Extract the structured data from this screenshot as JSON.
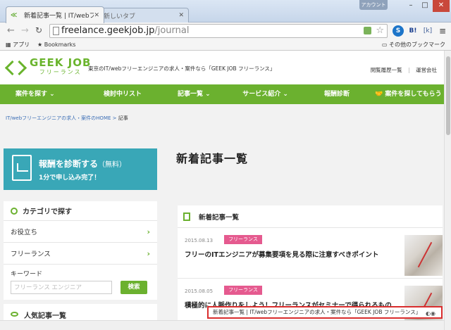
{
  "browser": {
    "tabs": [
      {
        "title": "新着記事一覧 | IT/webフ",
        "active": true
      },
      {
        "title": "新しいタブ",
        "active": false
      }
    ],
    "account_label": "アカウント",
    "url_host": "freelance.geekjob.jp",
    "url_path": "/journal",
    "bookmarks": {
      "apps": "アプリ",
      "bookmarks": "Bookmarks",
      "other": "その他のブックマーク"
    },
    "extensions": [
      "S",
      "B!",
      "[k]",
      "≡"
    ]
  },
  "header": {
    "logo_name": "GEEK JOB",
    "logo_sub": "フリーランス",
    "tagline": "東京のIT/webフリーエンジニアの求人・案件なら「GEEK JOB フリーランス」",
    "links": [
      "閲覧履歴一覧",
      "運営会社"
    ]
  },
  "nav": [
    "案件を探す ⌄",
    "検討中リスト",
    "記事一覧 ⌄",
    "サービス紹介 ⌄",
    "報酬診断",
    "案件を探してもらう"
  ],
  "breadcrumb": {
    "home": "IT/webフリーエンジニアの求人・案件のHOME",
    "sep": ">",
    "current": "記事"
  },
  "banner": {
    "title": "報酬を診断する",
    "title_suffix": "（無料）",
    "subtitle": "1分で申し込み完了！"
  },
  "sidebar": {
    "category_heading": "カテゴリで探す",
    "categories": [
      "お役立ち",
      "フリーランス"
    ],
    "keyword_label": "キーワード",
    "keyword_placeholder": "フリーランス エンジニア",
    "search_button": "検索",
    "popular_heading": "人気記事一覧"
  },
  "main": {
    "page_title": "新着記事一覧",
    "feed_heading": "新着記事一覧",
    "articles": [
      {
        "date": "2015.08.13",
        "category": "フリーランス",
        "title": "フリーのITエンジニアが募集要項を見る際に注意すべきポイント"
      },
      {
        "date": "2015.08.05",
        "category": "フリーランス",
        "title": "積極的に人脈作りをしよう！フリーランスがセミナーで得られるもの"
      }
    ]
  },
  "tooltip": {
    "text": "新着記事一覧 | IT/webフリーエンジニアの求人・案件なら「GEEK JOB フリーランス」"
  },
  "colors": {
    "brand_green": "#6bb12f",
    "banner_teal": "#39a7b7",
    "category_pink": "#e55a8f",
    "highlight_red": "#d92d2d"
  }
}
